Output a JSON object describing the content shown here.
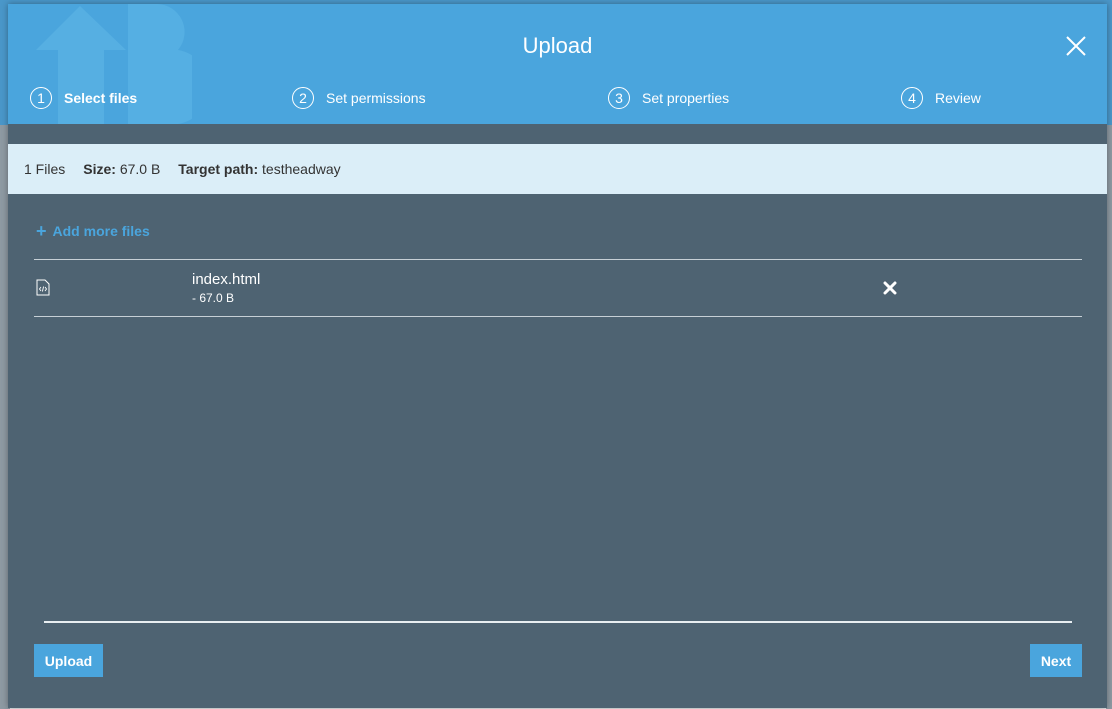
{
  "modal": {
    "title": "Upload",
    "steps": [
      {
        "number": "1",
        "label": "Select files"
      },
      {
        "number": "2",
        "label": "Set permissions"
      },
      {
        "number": "3",
        "label": "Set properties"
      },
      {
        "number": "4",
        "label": "Review"
      }
    ],
    "active_step": 1
  },
  "summary": {
    "files_count": "1 Files",
    "size_label": "Size:",
    "size_value": "67.0 B",
    "target_label": "Target path:",
    "target_value": "testheadway"
  },
  "add_more": {
    "label": "Add more files"
  },
  "files": [
    {
      "name": "index.html",
      "size": "- 67.0 B",
      "icon": "html-file-icon"
    }
  ],
  "footer": {
    "upload_label": "Upload",
    "next_label": "Next"
  },
  "colors": {
    "header": "#4aa5dd",
    "body": "#4e6372",
    "info_bar": "#dbeef8",
    "accent": "#4aa5dd"
  }
}
